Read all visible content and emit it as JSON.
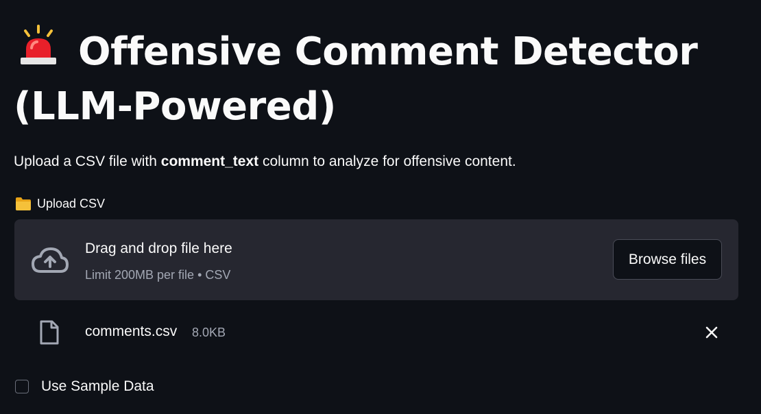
{
  "header": {
    "icon": "rotating-light-siren-icon",
    "title": "Offensive Comment Detector (LLM-Powered)"
  },
  "intro": {
    "prefix": "Upload a CSV file with ",
    "column_name": "comment_text",
    "suffix": " column to analyze for offensive content."
  },
  "uploader": {
    "label_icon": "folder-icon",
    "label": "Upload CSV",
    "dropzone_icon": "cloud-upload-icon",
    "dropzone_title": "Drag and drop file here",
    "dropzone_subtitle": "Limit 200MB per file • CSV",
    "browse_label": "Browse files",
    "file": {
      "icon": "file-icon",
      "name": "comments.csv",
      "size": "8.0KB",
      "remove_icon": "close-icon"
    }
  },
  "sample_data": {
    "label": "Use Sample Data",
    "checked": false
  },
  "colors": {
    "background": "#0e1117",
    "dropzone": "#262730",
    "muted_text": "#a3a8b4",
    "siren_red": "#e8202a",
    "folder_yellow": "#f5c13a"
  }
}
